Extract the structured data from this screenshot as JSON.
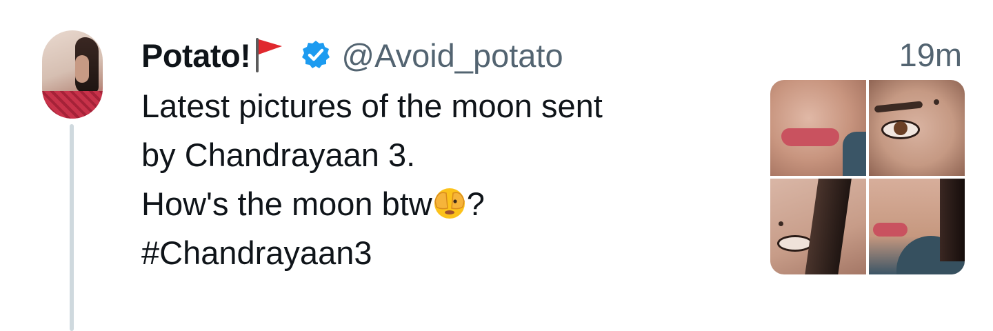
{
  "tweet": {
    "author": {
      "name": "Potato!",
      "handle": "@Avoid_potato",
      "verified": true,
      "flag_emoji": "red-flag",
      "avatar_icon": "profile-photo"
    },
    "timestamp": "19m",
    "text_lines": [
      "Latest pictures of the moon sent",
      "by Chandrayaan 3.",
      "How's the moon btw",
      "#Chandrayaan3"
    ],
    "line3_suffix": "?",
    "inline_emoji": "face-with-peeking-eye",
    "media": {
      "layout": "2x2-grid",
      "count": 4
    }
  },
  "colors": {
    "text_primary": "#0f1419",
    "text_secondary": "#536471",
    "verified_blue": "#1d9bf0",
    "thread_line": "#cfd9de",
    "flag_red": "#e0282e"
  }
}
